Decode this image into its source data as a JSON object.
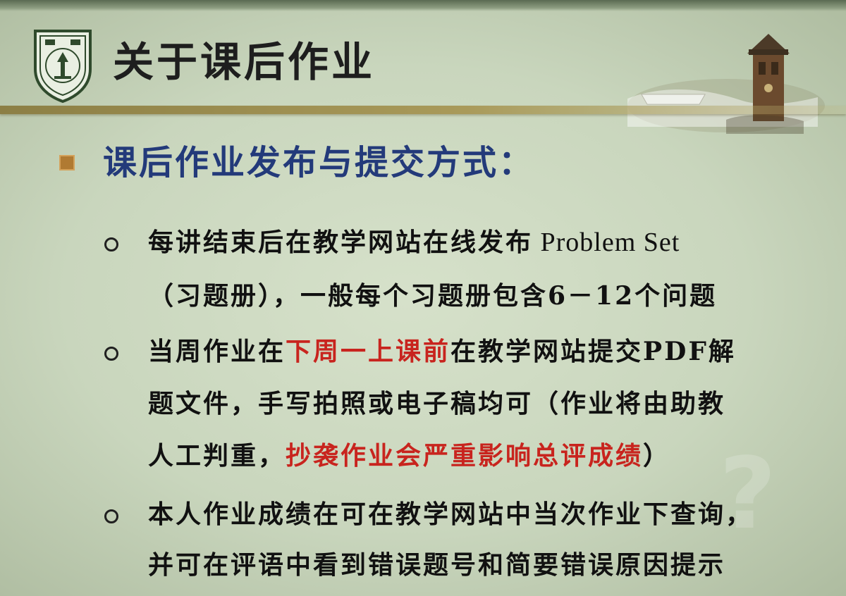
{
  "slide": {
    "title": "关于课后作业",
    "bullet": "课后作业发布与提交方式：",
    "items": [
      {
        "line1": "每讲结束后在教学网站在线发布",
        "line1_latin": " Problem Set",
        "line2": "（习题册），一般每个习题册包含6－12个问题"
      },
      {
        "line1_a": "当周作业在",
        "line1_red": "下周一上课前",
        "line1_b": "在教学网站提交PDF解",
        "line2": "题文件，手写拍照或电子稿均可（作业将由助教",
        "line3_a": "人工判重，",
        "line3_red": "抄袭作业会严重影响总评成绩",
        "line3_b": "）"
      },
      {
        "line1": "本人作业成绩在可在教学网站中当次作业下查询，",
        "line2": "并可在评语中看到错误题号和简要错误原因提示"
      }
    ]
  },
  "icons": {
    "logo": "university-seal-icon",
    "decoration": "bell-tower-illustration",
    "bullet_marker": "square-bullet-icon",
    "sub_marker": "circle-bullet-icon"
  },
  "colors": {
    "background": "#cbd8bf",
    "heading": "#233a7a",
    "body_text": "#111111",
    "emphasis": "#c8241e",
    "bullet_marker": "#b07a32",
    "rule": "#9c8e50"
  }
}
